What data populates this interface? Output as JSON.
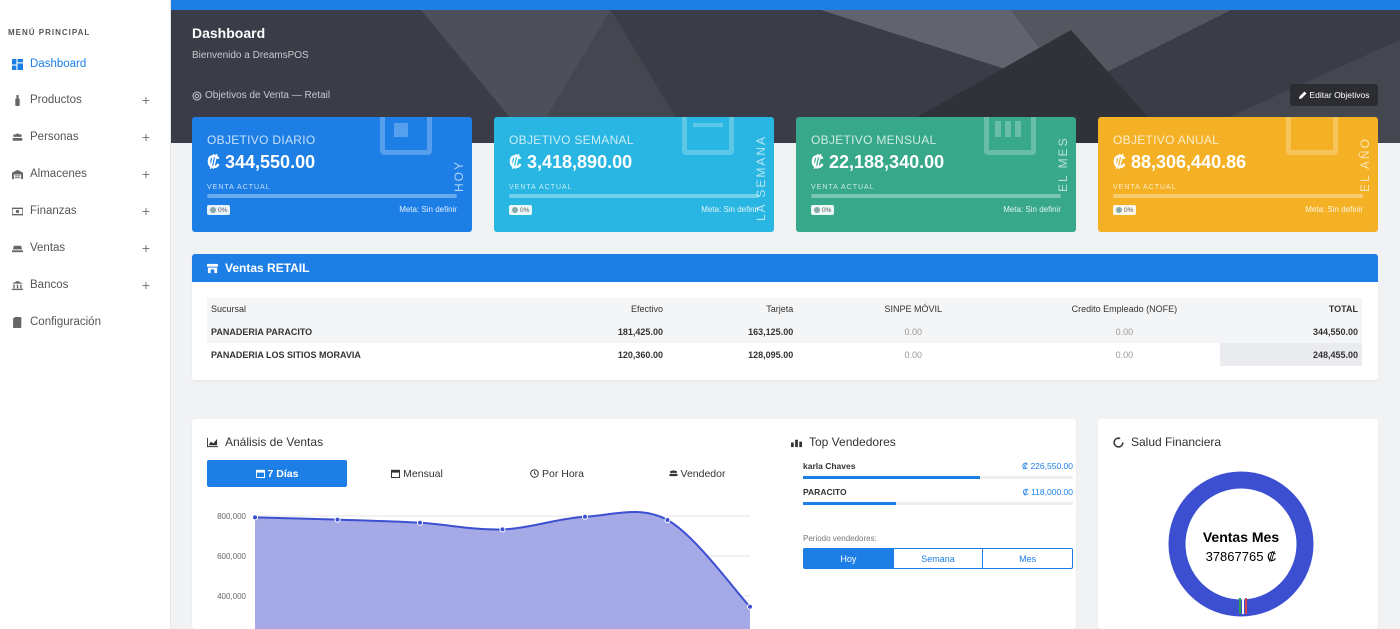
{
  "sidebar": {
    "title": "MENÚ PRINCIPAL",
    "items": [
      {
        "label": "Dashboard",
        "icon": "dashboard-icon",
        "expandable": false
      },
      {
        "label": "Productos",
        "icon": "bottle-icon",
        "expandable": true
      },
      {
        "label": "Personas",
        "icon": "users-icon",
        "expandable": true
      },
      {
        "label": "Almacenes",
        "icon": "warehouse-icon",
        "expandable": true
      },
      {
        "label": "Finanzas",
        "icon": "money-icon",
        "expandable": true
      },
      {
        "label": "Ventas",
        "icon": "sales-icon",
        "expandable": true
      },
      {
        "label": "Bancos",
        "icon": "bank-icon",
        "expandable": true
      },
      {
        "label": "Configuración",
        "icon": "book-icon",
        "expandable": false
      }
    ],
    "expand_symbol": "+"
  },
  "header": {
    "title": "Dashboard",
    "subtitle": "Bienvenido a DreamsPOS",
    "objectives_label": "Objetivos de Venta — Retail",
    "edit_button": "Editar Objetivos"
  },
  "cards": [
    {
      "title": "OBJETIVO DIARIO",
      "amount": "₡ 344,550.00",
      "vertical": "HOY",
      "label": "VENTA ACTUAL",
      "percent": "0%",
      "meta": "Meta: Sin definir",
      "color": "#1d7fe6"
    },
    {
      "title": "OBJETIVO SEMANAL",
      "amount": "₡ 3,418,890.00",
      "vertical": "LA SEMANA",
      "label": "VENTA ACTUAL",
      "percent": "0%",
      "meta": "Meta: Sin definir",
      "color": "#29b6e2"
    },
    {
      "title": "OBJETIVO MENSUAL",
      "amount": "₡ 22,188,340.00",
      "vertical": "EL MES",
      "label": "VENTA ACTUAL",
      "percent": "0%",
      "meta": "Meta: Sin definir",
      "color": "#37a98a"
    },
    {
      "title": "OBJETIVO ANUAL",
      "amount": "₡ 88,306,440.86",
      "vertical": "EL AÑO",
      "label": "VENTA ACTUAL",
      "percent": "0%",
      "meta": "Meta: Sin definir",
      "color": "#f4b126"
    }
  ],
  "retail": {
    "title": "Ventas RETAIL",
    "columns": [
      "Sucursal",
      "Efectivo",
      "Tarjeta",
      "SINPE MÓVIL",
      "Credito Empleado (NOFE)",
      "TOTAL"
    ],
    "rows": [
      [
        "PANADERIA PARACITO",
        "181,425.00",
        "163,125.00",
        "0.00",
        "0.00",
        "344,550.00"
      ],
      [
        "PANADERIA LOS SITIOS MORAVIA",
        "120,360.00",
        "128,095.00",
        "0.00",
        "0.00",
        "248,455.00"
      ]
    ]
  },
  "analysis": {
    "title": "Análisis de Ventas",
    "tabs": [
      "7 Días",
      "Mensual",
      "Por Hora",
      "Vendedor"
    ],
    "active_tab": 0
  },
  "chart_data": {
    "type": "area",
    "x": [
      1,
      2,
      3,
      4,
      5,
      6,
      7
    ],
    "values": [
      793000,
      782000,
      766000,
      733000,
      796000,
      780000,
      346000
    ],
    "yticks": [
      "800,000",
      "600,000",
      "400,000"
    ],
    "ytick_values": [
      800000,
      600000,
      400000
    ],
    "ylim": [
      250000,
      860000
    ],
    "color": "#3d4fd1"
  },
  "top": {
    "title": "Top Vendedores",
    "sellers": [
      {
        "name": "karla Chaves",
        "value": "₡ 226,550.00",
        "fraction": 0.657
      },
      {
        "name": "PARACITO",
        "value": "₡ 118,000.00",
        "fraction": 0.344
      }
    ],
    "period_label": "Periodo vendedores:",
    "periods": [
      "Hoy",
      "Semana",
      "Mes"
    ],
    "active_period": 0
  },
  "salud": {
    "title": "Salud Financiera",
    "center_title": "Ventas Mes",
    "center_value": "37867765 ₡"
  }
}
